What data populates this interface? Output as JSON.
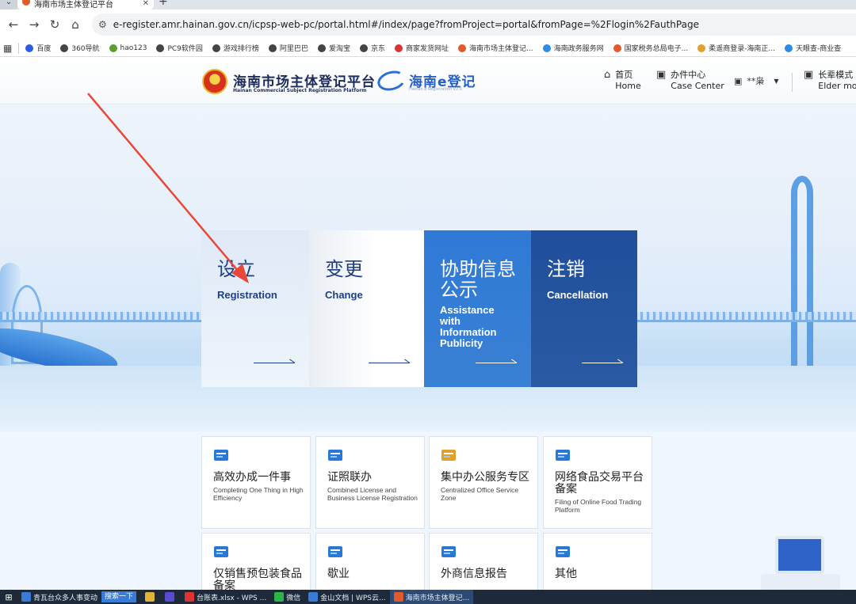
{
  "browser": {
    "tab_dropdown": "⌄",
    "tab_title": "海南市场主体登记平台",
    "tab_close": "✕",
    "new_tab": "+",
    "back": "←",
    "forward": "→",
    "reload": "↻",
    "home": "⌂",
    "url": "e-register.amr.hainan.gov.cn/icpsp-web-pc/portal.html#/index/page?fromProject=portal&fromPage=%2Flogin%2FauthPage",
    "apps_icon": "▦",
    "bookmarks": [
      {
        "label": "百度",
        "color": "#2d5be3"
      },
      {
        "label": "360导航",
        "color": "#444"
      },
      {
        "label": "hao123",
        "color": "#5aa02c"
      },
      {
        "label": "PC9软件园",
        "color": "#444"
      },
      {
        "label": "游戏排行榜",
        "color": "#444"
      },
      {
        "label": "阿里巴巴",
        "color": "#444"
      },
      {
        "label": "爱淘宝",
        "color": "#444"
      },
      {
        "label": "京东",
        "color": "#444"
      },
      {
        "label": "商家发货网址",
        "color": "#d33"
      },
      {
        "label": "海南市场主体登记...",
        "color": "#e05a2b"
      },
      {
        "label": "海南政务服务网",
        "color": "#2d8ce3"
      },
      {
        "label": "国家税务总局电子...",
        "color": "#e05a2b"
      },
      {
        "label": "柔遥商登录-海南正...",
        "color": "#e0a02b"
      },
      {
        "label": "天眼查-商业查",
        "color": "#2d8ce3"
      }
    ]
  },
  "header": {
    "brand_title": "海南市场主体登记平台",
    "brand_sub": "Hainan Commercial Subject Registration Platform",
    "logo2_title": "海南e登记",
    "logo2_sub": "Hainan e Registration V2.0",
    "nav": [
      {
        "icon": "⌂",
        "zh": "首页",
        "en": "Home"
      },
      {
        "icon": "▣",
        "zh": "办件中心",
        "en": "Case Center"
      }
    ],
    "user_icon": "▣",
    "user_name": "**枭",
    "user_caret": "▼",
    "elder_icon": "▣",
    "elder_zh": "长辈模式",
    "elder_en": "Elder mode"
  },
  "hero_cards": [
    {
      "zh": "设立",
      "en": "Registration"
    },
    {
      "zh": "变更",
      "en": "Change"
    },
    {
      "zh": "协助信息公示",
      "en": "Assistance with Information Publicity"
    },
    {
      "zh": "注销",
      "en": "Cancellation"
    }
  ],
  "services": [
    {
      "zh": "高效办成一件事",
      "en": "Completing One Thing in High Efficiency",
      "icon": "swirl-icon"
    },
    {
      "zh": "证照联办",
      "en": "Combined License and Business License Registration",
      "icon": "license-icon"
    },
    {
      "zh": "集中办公服务专区",
      "en": "Centralized Office Service Zone",
      "icon": "office-icon"
    },
    {
      "zh": "网络食品交易平台备案",
      "en": "Filing of Online Food Trading Platform",
      "icon": "monitor-icon"
    },
    {
      "zh": "仅销售预包装食品备案",
      "en": "",
      "icon": "card-icon"
    },
    {
      "zh": "歇业",
      "en": "",
      "icon": "doc-icon"
    },
    {
      "zh": "外商信息报告",
      "en": "",
      "icon": "report-icon"
    },
    {
      "zh": "其他",
      "en": "",
      "icon": "grid-icon"
    }
  ],
  "taskbar": {
    "start_icon": "⊞",
    "items": [
      {
        "label": "青瓦台众多人事变动",
        "color": "#3a7bd5"
      },
      {
        "label": "",
        "color": "#e0b33a"
      },
      {
        "label": "",
        "color": "#5a4bd0"
      },
      {
        "label": "台账表.xlsx - WPS ...",
        "color": "#d33"
      },
      {
        "label": "微信",
        "color": "#2db34a"
      },
      {
        "label": "金山文档 | WPS云...",
        "color": "#3a7bd5"
      },
      {
        "label": "海南市场主体登记...",
        "color": "#e05a2b"
      }
    ],
    "search_label": "搜索一下"
  },
  "colors": {
    "primary_blue": "#2f7ad6",
    "dark_blue": "#1f4f9c",
    "annotation_arrow": "#e8473a"
  }
}
